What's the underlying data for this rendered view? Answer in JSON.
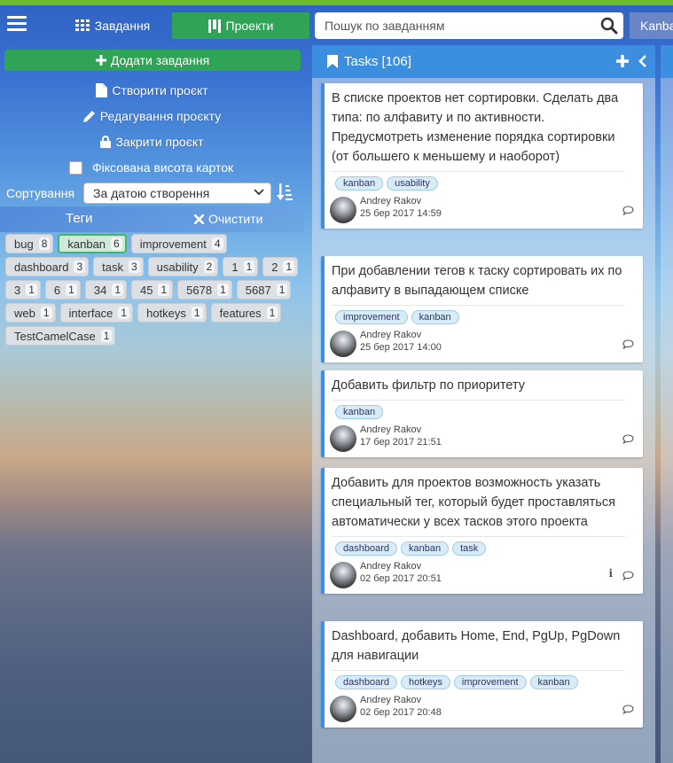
{
  "header": {
    "tasks_tab": "Завдання",
    "projects_tab": "Проекти",
    "search_placeholder": "Пошук по завданням",
    "kanban_tab": "Kanban"
  },
  "sidebar": {
    "add_task": "Додати завдання",
    "create_project": "Створити проєкт",
    "edit_project": "Редагування проєкту",
    "close_project": "Закрити проєкт",
    "fixed_height": "Фіксована висота карток",
    "sort_label": "Сортування",
    "sort_value": "За датою створення",
    "tags_title": "Теги",
    "clear": "Очистити",
    "tags": [
      {
        "name": "bug",
        "count": "8"
      },
      {
        "name": "kanban",
        "count": "6"
      },
      {
        "name": "improvement",
        "count": "4"
      },
      {
        "name": "dashboard",
        "count": "3"
      },
      {
        "name": "task",
        "count": "3"
      },
      {
        "name": "usability",
        "count": "2"
      },
      {
        "name": "1",
        "count": "1"
      },
      {
        "name": "2",
        "count": "1"
      },
      {
        "name": "3",
        "count": "1"
      },
      {
        "name": "6",
        "count": "1"
      },
      {
        "name": "34",
        "count": "1"
      },
      {
        "name": "45",
        "count": "1"
      },
      {
        "name": "5678",
        "count": "1"
      },
      {
        "name": "5687",
        "count": "1"
      },
      {
        "name": "web",
        "count": "1"
      },
      {
        "name": "interface",
        "count": "1"
      },
      {
        "name": "hotkeys",
        "count": "1"
      },
      {
        "name": "features",
        "count": "1"
      },
      {
        "name": "TestCamelCase",
        "count": "1"
      }
    ]
  },
  "column": {
    "title": "Tasks [106]",
    "cards": [
      {
        "text": "В списке проектов нет сортировки. Сделать два типа: по алфавиту и по активности. Предусмотреть изменение порядка сортировки (от большего к меньшему и наоборот)",
        "tags": [
          "kanban",
          "usability"
        ],
        "author": "Andrey Rakov",
        "date": "25 бер 2017 14:59"
      },
      {
        "text": "При добавлении тегов к таску сортировать их по алфавиту в выпадающем списке",
        "tags": [
          "improvement",
          "kanban"
        ],
        "author": "Andrey Rakov",
        "date": "25 бер 2017 14:00"
      },
      {
        "text": "Добавить фильтр по приоритету",
        "tags": [
          "kanban"
        ],
        "author": "Andrey Rakov",
        "date": "17 бер 2017 21:51"
      },
      {
        "text": "Добавить для проектов возможность указать специальный тег, который будет проставляться автоматически у всех тасков этого проекта",
        "tags": [
          "dashboard",
          "kanban",
          "task"
        ],
        "author": "Andrey Rakov",
        "date": "02 бер 2017 20:51"
      },
      {
        "text": "Dashboard, добавить Home, End, PgUp, PgDown для навигации",
        "tags": [
          "dashboard",
          "hotkeys",
          "improvement",
          "kanban"
        ],
        "author": "Andrey Rakov",
        "date": "02 бер 2017 20:48"
      }
    ]
  }
}
